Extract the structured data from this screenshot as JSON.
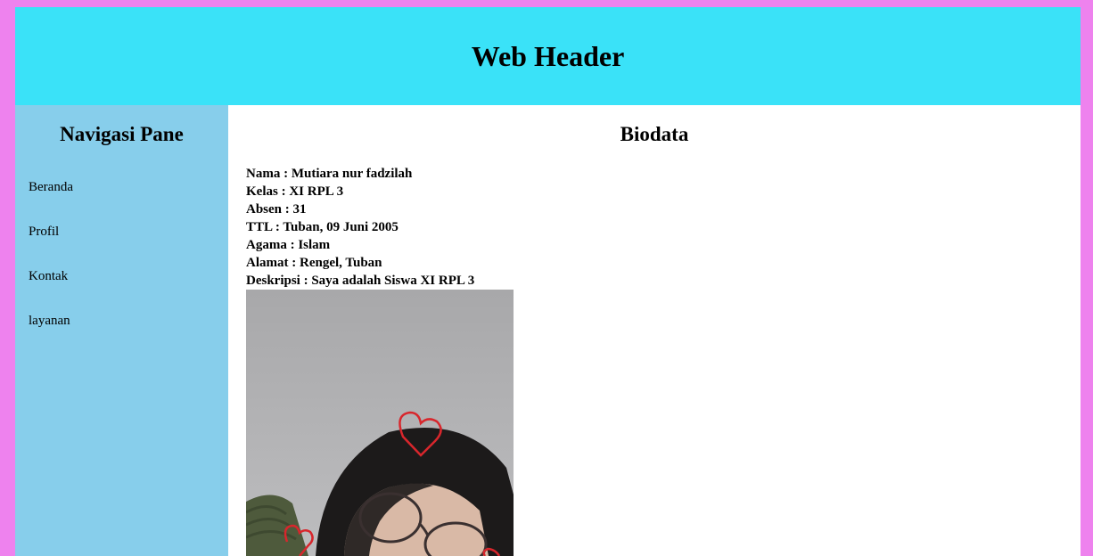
{
  "header": {
    "title": "Web Header"
  },
  "sidebar": {
    "title": "Navigasi Pane",
    "items": [
      {
        "label": "Beranda"
      },
      {
        "label": "Profil"
      },
      {
        "label": "Kontak"
      },
      {
        "label": "layanan"
      }
    ]
  },
  "main": {
    "title": "Biodata",
    "bio": [
      "Nama : Mutiara nur fadzilah",
      "Kelas : XI RPL 3",
      "Absen : 31",
      "TTL : Tuban, 09 Juni 2005",
      "Agama : Islam",
      "Alamat : Rengel, Tuban",
      "Deskripsi : Saya adalah Siswa XI RPL 3"
    ]
  },
  "colors": {
    "page_background": "#ee82ee",
    "header_background": "#3ae2f8",
    "sidebar_background": "#87ceeb",
    "main_background": "#ffffff"
  }
}
